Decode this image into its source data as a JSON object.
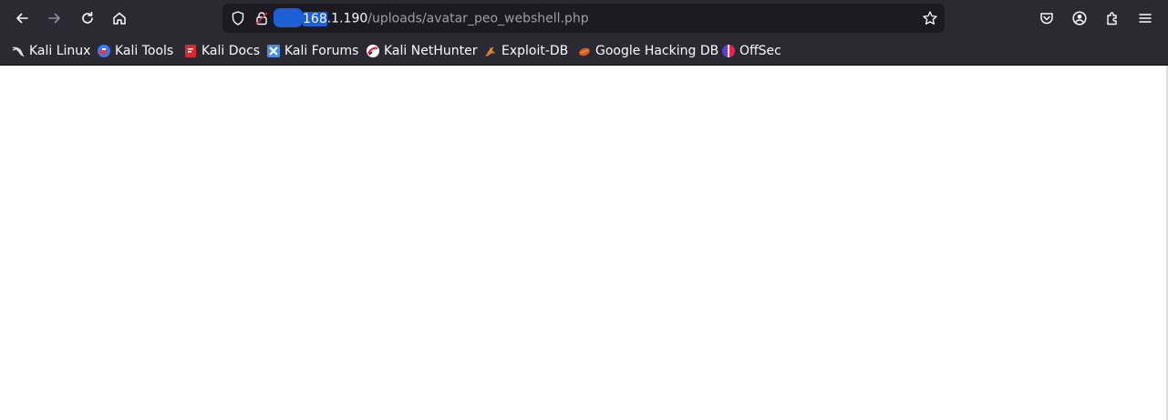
{
  "nav": {
    "back": "back-icon",
    "forward": "forward-icon",
    "reload": "reload-icon",
    "home": "home-icon"
  },
  "urlbar": {
    "host_highlighted": "168",
    "host_rest": ".1.190",
    "path": "/uploads/avatar_peo_webshell.php"
  },
  "toolbar_icons": [
    "pocket-icon",
    "account-icon",
    "extensions-icon",
    "menu-icon"
  ],
  "bookmarks": [
    {
      "label": "Kali Linux",
      "icon": "kali-dragon-icon"
    },
    {
      "label": "Kali Tools",
      "icon": "kali-tools-icon"
    },
    {
      "label": "Kali Docs",
      "icon": "kali-docs-icon"
    },
    {
      "label": "Kali Forums",
      "icon": "kali-forums-icon"
    },
    {
      "label": "Kali NetHunter",
      "icon": "nethunter-icon"
    },
    {
      "label": "Exploit-DB",
      "icon": "exploit-db-icon"
    },
    {
      "label": "Google Hacking DB",
      "icon": "ghdb-icon"
    },
    {
      "label": "OffSec",
      "icon": "offsec-icon"
    }
  ],
  "colors": {
    "chrome": "#2b2a33",
    "urlbar": "#1c1b22",
    "text": "#fbfbfe",
    "redaction": "#1f5fd6"
  }
}
